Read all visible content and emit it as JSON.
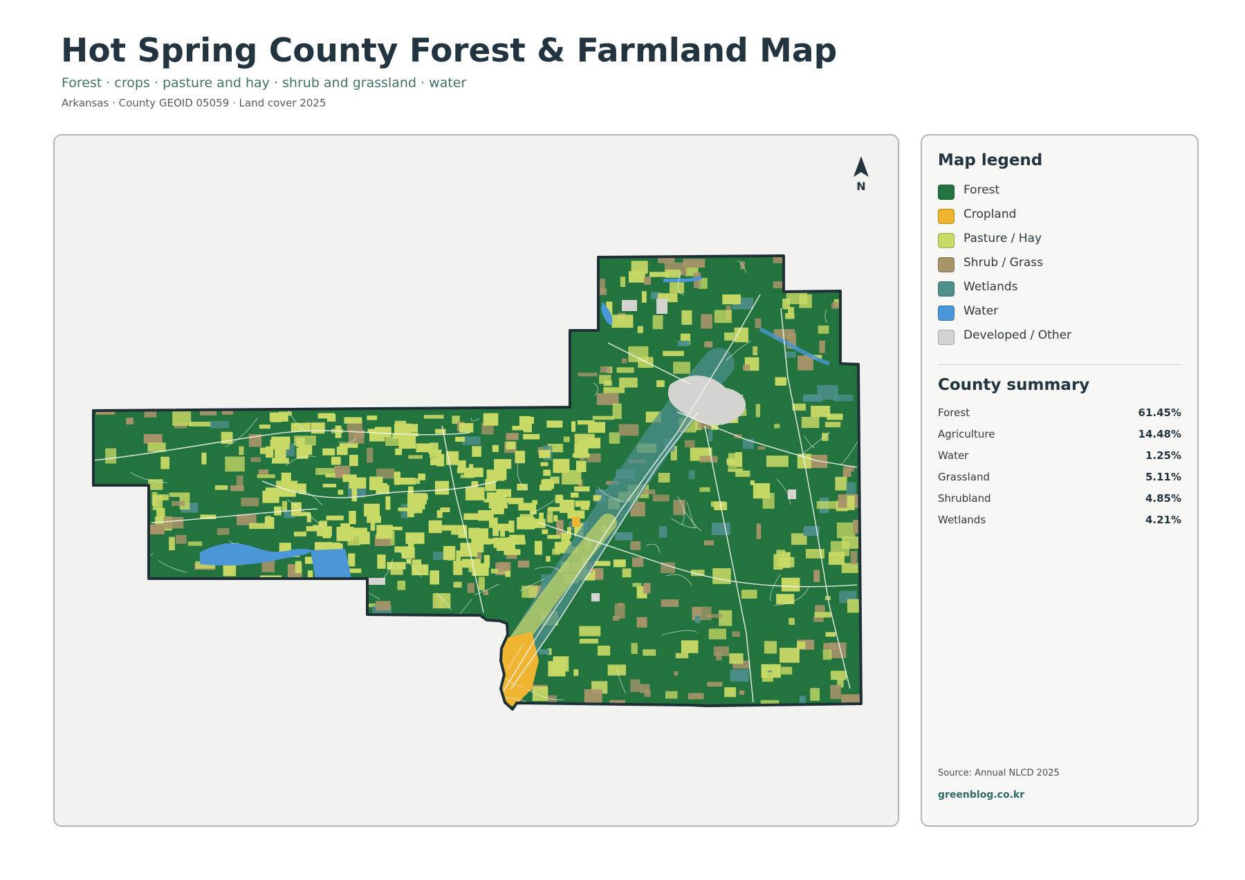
{
  "header": {
    "title": "Hot Spring County Forest & Farmland Map",
    "subtitle": "Forest · crops · pasture and hay · shrub and grassland · water",
    "meta": "Arkansas · County GEOID 05059 · Land cover 2025"
  },
  "map": {
    "north_label": "N",
    "colors": {
      "forest": "#22733e",
      "cropland": "#f0b530",
      "pasture": "#c9d965",
      "shrub": "#a9946a",
      "wetlands": "#4e8f8c",
      "water": "#4a96d6",
      "developed": "#d3d3d0",
      "background": "#f2f2f0",
      "border": "#1e2f36"
    }
  },
  "legend": {
    "title": "Map legend",
    "items": [
      {
        "label": "Forest",
        "color": "#22733e"
      },
      {
        "label": "Cropland",
        "color": "#f0b530"
      },
      {
        "label": "Pasture / Hay",
        "color": "#c9d965"
      },
      {
        "label": "Shrub / Grass",
        "color": "#a9946a"
      },
      {
        "label": "Wetlands",
        "color": "#4e8f8c"
      },
      {
        "label": "Water",
        "color": "#4a96d6"
      },
      {
        "label": "Developed / Other",
        "color": "#d3d3d0"
      }
    ]
  },
  "summary": {
    "title": "County summary",
    "rows": [
      {
        "label": "Forest",
        "value": "61.45%"
      },
      {
        "label": "Agriculture",
        "value": "14.48%"
      },
      {
        "label": "Water",
        "value": "1.25%"
      },
      {
        "label": "Grassland",
        "value": "5.11%"
      },
      {
        "label": "Shrubland",
        "value": "4.85%"
      },
      {
        "label": "Wetlands",
        "value": "4.21%"
      }
    ]
  },
  "footer": {
    "source": "Source: Annual NLCD 2025",
    "site": "greenblog.co.kr"
  }
}
